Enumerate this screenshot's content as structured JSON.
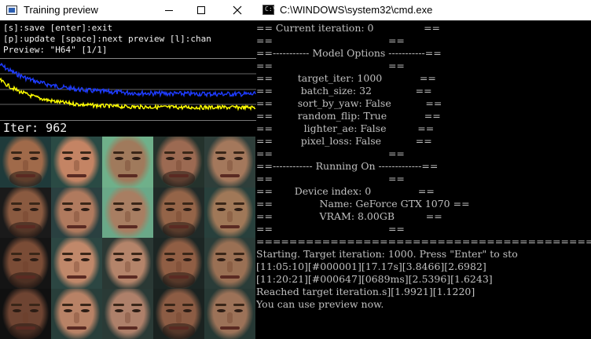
{
  "left_window": {
    "title": "Training preview",
    "controls": {
      "minimize": "minimize",
      "maximize": "maximize",
      "close": "close"
    },
    "help_lines": [
      "[s]:save [enter]:exit",
      "[p]:update [space]:next preview [l]:chan",
      "Preview: \"H64\" [1/1]"
    ],
    "iteration_label": "Iter: 962",
    "graph": {
      "series": [
        {
          "name": "",
          "color": "#1e3cff"
        },
        {
          "name": "",
          "color": "#ffff00"
        }
      ]
    },
    "preview_faces": [
      [
        "#a06a4a",
        "#c48464",
        "#a07a5c",
        "#9c6a52",
        "#a4785c"
      ],
      [
        "#8a5a40",
        "#b07a5e",
        "#a87e62",
        "#946448",
        "#a07858"
      ],
      [
        "#7a4c36",
        "#c0886a",
        "#b4846a",
        "#905e44",
        "#9a7054"
      ],
      [
        "#6e4432",
        "#b88266",
        "#ae806a",
        "#8c5c44",
        "#9c7258"
      ]
    ],
    "face_backgrounds": [
      [
        "#1f3a3a",
        "#2a4a44",
        "#6fb08a",
        "#24322c",
        "#2e3e3a"
      ],
      [
        "#1a1a1a",
        "#2a4040",
        "#6aa888",
        "#202a28",
        "#28403c"
      ],
      [
        "#141414",
        "#2c4642",
        "#2a3834",
        "#1c2624",
        "#2a3c38"
      ],
      [
        "#101010",
        "#283e3a",
        "#2a3a36",
        "#1a2220",
        "#263834"
      ]
    ]
  },
  "right_window": {
    "title": "C:\\WINDOWS\\system32\\cmd.exe",
    "icon_label": "C:\\",
    "console_lines": [
      "== Current iteration: 0                ==",
      "==                                     ==",
      "==----------- Model Options -----------==",
      "==                                     ==",
      "==        target_iter: 1000            ==",
      "==         batch_size: 32              ==",
      "==        sort_by_yaw: False           ==",
      "==        random_flip: True            ==",
      "==          lighter_ae: False          ==",
      "==         pixel_loss: False           ==",
      "==                                     ==",
      "==------------ Running On -------------==",
      "==                                     ==",
      "==       Device index: 0               ==",
      "==               Name: GeForce GTX 1070 ==",
      "==               VRAM: 8.00GB          ==",
      "==                                     ==",
      "=========================================",
      "Starting. Target iteration: 1000. Press \"Enter\" to sto",
      "[11:05:10][#000001][17.17s][3.8466][2.6982]",
      "[11:20:21][#000647][0689ms][2.5396][1.6243]",
      "Reached target iteration.s][1.9921][1.1220]",
      "You can use preview now."
    ]
  }
}
